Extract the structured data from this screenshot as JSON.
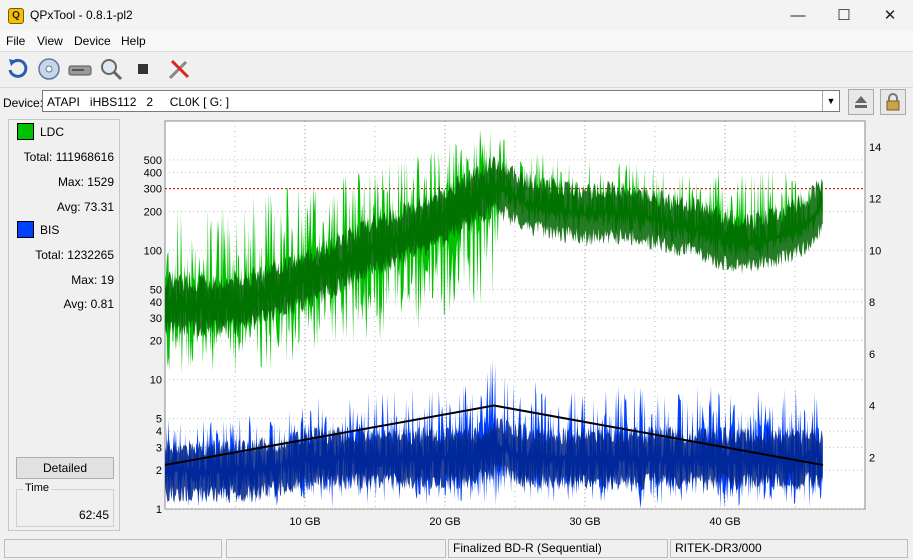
{
  "window": {
    "title": "QPxTool - 0.8.1-pl2",
    "icon_letter": "Q"
  },
  "menu": {
    "file": "File",
    "view": "View",
    "device": "Device",
    "help": "Help"
  },
  "toolbar": {
    "buttons": [
      "refresh-icon",
      "disc-icon",
      "drive-icon",
      "magnifier-icon",
      "stop-icon",
      "tools-icon"
    ]
  },
  "device": {
    "label": "Device:",
    "value": "ATAPI   iHBS112   2     CL0K [ G: ]"
  },
  "ldc": {
    "name": "LDC",
    "color": "#00c000",
    "total_label": "Total:",
    "total": "111968616",
    "max_label": "Max:",
    "max": "1529",
    "avg_label": "Avg:",
    "avg": "73.31"
  },
  "bis": {
    "name": "BIS",
    "color": "#0040ff",
    "total_label": "Total:",
    "total": "1232265",
    "max_label": "Max:",
    "max": "19",
    "avg_label": "Avg:",
    "avg": "0.81"
  },
  "buttons": {
    "detailed": "Detailed"
  },
  "time": {
    "label": "Time",
    "value": "62:45"
  },
  "status": {
    "cell3": "Finalized BD-R (Sequential)",
    "cell4": "RITEK-DR3/000"
  },
  "chart_data": {
    "type": "line",
    "x_unit": "GB",
    "x_range": [
      0,
      50
    ],
    "x_ticks": [
      10,
      20,
      30,
      40
    ],
    "x_tick_labels": [
      "10 GB",
      "20 GB",
      "30 GB",
      "40 GB"
    ],
    "y_left_scale": "log",
    "y_left_range": [
      1,
      1000
    ],
    "y_left_ticks": [
      1,
      2,
      3,
      4,
      5,
      10,
      20,
      30,
      40,
      50,
      100,
      200,
      300,
      400,
      500
    ],
    "y_right_range": [
      0,
      15
    ],
    "y_right_ticks": [
      2,
      4,
      6,
      8,
      10,
      12,
      14
    ],
    "red_reference_line_left_value": 300,
    "grid": true,
    "series": [
      {
        "name": "LDC",
        "kind": "band",
        "color": "#00c000",
        "x": [
          0,
          2,
          4,
          6,
          8,
          10,
          12,
          14,
          16,
          18,
          20,
          22,
          23.5,
          24,
          26,
          28,
          30,
          32,
          34,
          36,
          38,
          40,
          42,
          44,
          46,
          47
        ],
        "low": [
          9,
          10,
          10,
          11,
          12,
          14,
          16,
          18,
          20,
          23,
          25,
          30,
          28,
          220,
          160,
          140,
          130,
          125,
          120,
          100,
          85,
          75,
          80,
          90,
          120,
          150
        ],
        "mid": [
          40,
          38,
          38,
          42,
          50,
          60,
          75,
          100,
          120,
          150,
          190,
          260,
          320,
          300,
          230,
          210,
          190,
          200,
          190,
          160,
          150,
          120,
          115,
          130,
          170,
          230
        ],
        "high": [
          250,
          230,
          250,
          300,
          320,
          330,
          380,
          420,
          480,
          550,
          650,
          800,
          1000,
          800,
          600,
          550,
          500,
          520,
          500,
          480,
          460,
          440,
          460,
          460,
          450,
          400
        ]
      },
      {
        "name": "BIS",
        "kind": "band",
        "color": "#0040ff",
        "x": [
          0,
          2,
          4,
          6,
          8,
          10,
          12,
          14,
          16,
          18,
          20,
          22,
          23.5,
          24,
          26,
          28,
          30,
          32,
          34,
          36,
          38,
          40,
          42,
          44,
          46,
          47
        ],
        "low": [
          1,
          1,
          1,
          1,
          1,
          1,
          1,
          1,
          1,
          1,
          1,
          1,
          1,
          1,
          1,
          1,
          1,
          1,
          1,
          1,
          1,
          1,
          1,
          1,
          1,
          1
        ],
        "mid": [
          2,
          2,
          2,
          2,
          2.2,
          2.5,
          2.5,
          2.5,
          2.5,
          2.5,
          2.5,
          2.5,
          3,
          3,
          2.5,
          2.5,
          2.5,
          2.5,
          2.5,
          2.5,
          2.5,
          2.5,
          2.5,
          2.5,
          2.5,
          2.5
        ],
        "high": [
          5,
          5,
          5,
          5.5,
          6,
          7,
          8,
          9,
          9,
          9,
          9,
          10,
          15,
          12,
          10,
          9,
          9,
          9,
          9,
          9,
          9,
          9,
          9,
          9,
          9,
          9
        ]
      },
      {
        "name": "Speed",
        "kind": "line",
        "axis": "right",
        "color": "#000000",
        "x": [
          0,
          23.5,
          47
        ],
        "y": [
          1.7,
          4.0,
          1.7
        ]
      }
    ]
  }
}
